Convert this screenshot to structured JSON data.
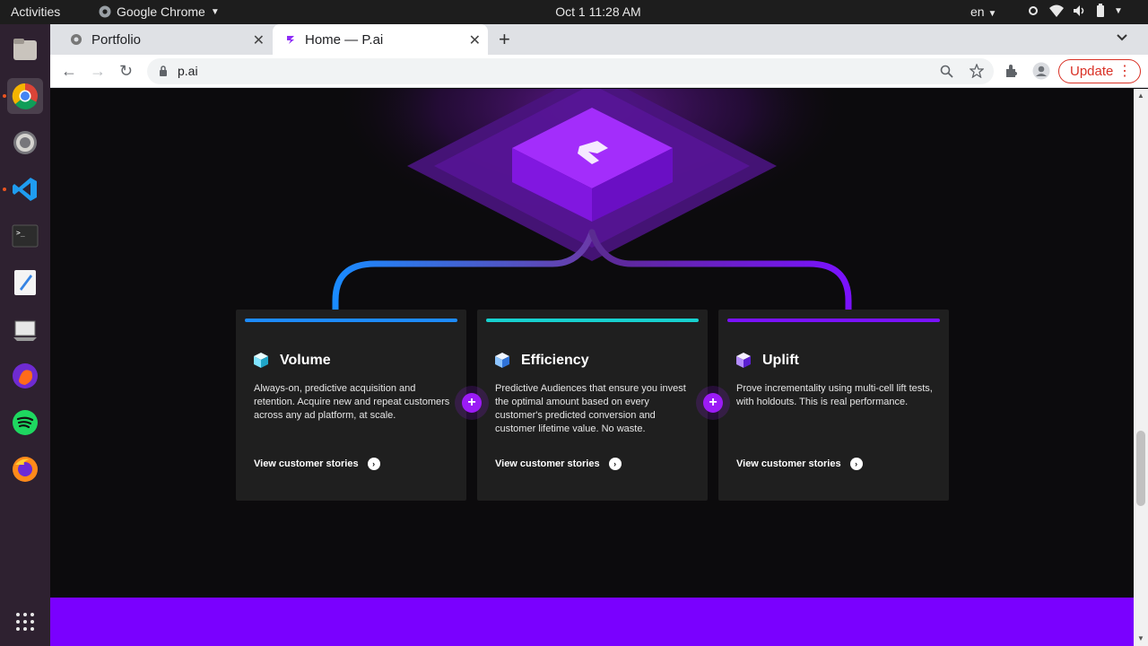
{
  "topbar": {
    "activities": "Activities",
    "app_name": "Google Chrome",
    "clock": "Oct 1  11:28 AM",
    "language": "en"
  },
  "browser": {
    "tabs": [
      {
        "title": "Portfolio",
        "active": false
      },
      {
        "title": "Home — P.ai",
        "active": true
      }
    ],
    "url": "p.ai",
    "update_label": "Update"
  },
  "page": {
    "cards": [
      {
        "title": "Volume",
        "body": "Always-on, predictive acquisition and retention. Acquire new and repeat customers across any ad platform, at scale.",
        "link": "View customer stories",
        "accent": "#1d8bff"
      },
      {
        "title": "Efficiency",
        "body": "Predictive Audiences that ensure you invest the optimal amount based on every customer's predicted conversion and customer lifetime value. No waste.",
        "link": "View customer stories",
        "accent": "#17d1cf"
      },
      {
        "title": "Uplift",
        "body": "Prove incrementality using multi-cell lift tests, with holdouts. This is real performance.",
        "link": "View customer stories",
        "accent": "#7a12ff"
      }
    ],
    "colors": {
      "band": "#7a00ff",
      "plus": "#9b1bf5"
    }
  }
}
